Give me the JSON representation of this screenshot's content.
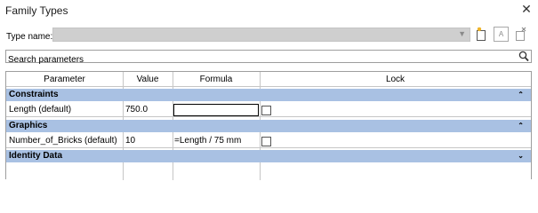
{
  "window": {
    "title": "Family Types",
    "close_glyph": "✕"
  },
  "type_name": {
    "label": "Type name:",
    "value": ""
  },
  "toolbar": {
    "rename_text": "A"
  },
  "search": {
    "placeholder": "Search parameters"
  },
  "table": {
    "columns": [
      "Parameter",
      "Value",
      "Formula",
      "Lock"
    ],
    "groups": [
      {
        "name": "Constraints",
        "expanded": true,
        "rows": [
          {
            "parameter": "Length (default)",
            "value": "750.0",
            "formula": "=",
            "locked": false
          }
        ]
      },
      {
        "name": "Graphics",
        "expanded": true,
        "rows": [
          {
            "parameter": "Number_of_Bricks (default)",
            "value": "10",
            "formula": "=Length / 75 mm",
            "locked": false
          }
        ]
      },
      {
        "name": "Identity Data",
        "expanded": false,
        "rows": []
      }
    ]
  },
  "colors": {
    "group_header": "#a9c1e3",
    "grid_line": "#c6c6c6",
    "disabled_field": "#cfcfcf"
  }
}
